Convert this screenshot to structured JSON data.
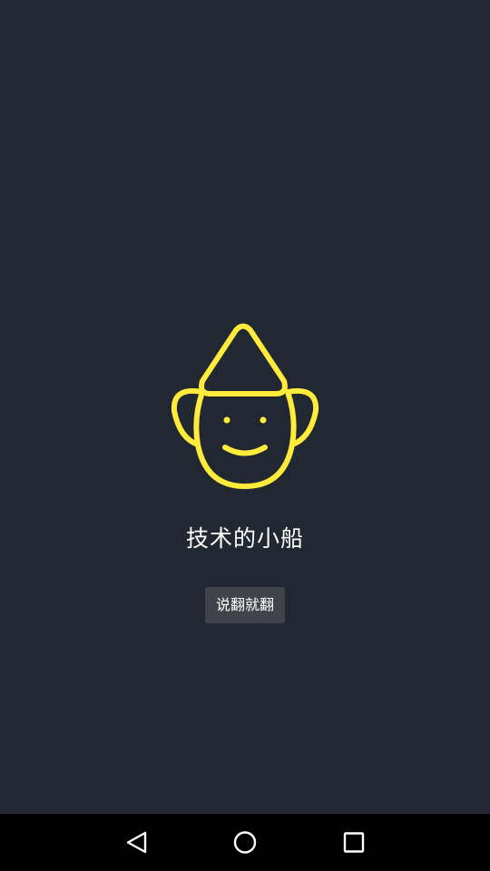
{
  "app": {
    "title": "技术的小船",
    "logo_icon": "elf-mascot-icon",
    "accent_color": "#ffeb3b",
    "background_color": "#222831"
  },
  "actions": {
    "flip_button_label": "说翻就翻"
  },
  "navigation_bar": {
    "back_icon": "triangle-back-icon",
    "home_icon": "circle-home-icon",
    "recents_icon": "square-recents-icon"
  }
}
